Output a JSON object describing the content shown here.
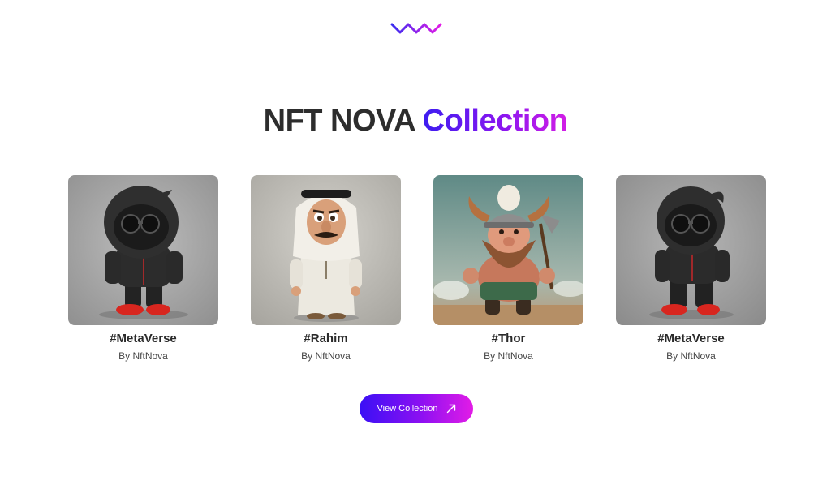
{
  "header": {
    "logo_icon": "zigzag-wave-logo-icon"
  },
  "heading": {
    "plain": "NFT NOVA",
    "accent": "Collection"
  },
  "colors": {
    "gradient_start": "#3a10f5",
    "gradient_end": "#e21ce6",
    "text": "#2d2d2d"
  },
  "cards": [
    {
      "title": "#MetaVerse",
      "author": "By NftNova",
      "image": "hooded-character-with-goggles"
    },
    {
      "title": "#Rahim",
      "author": "By NftNova",
      "image": "character-in-keffiyeh-and-thobe"
    },
    {
      "title": "#Thor",
      "author": "By NftNova",
      "image": "viking-character-with-axe"
    },
    {
      "title": "#MetaVerse",
      "author": "By NftNova",
      "image": "hooded-character-with-goggles"
    }
  ],
  "cta": {
    "label": "View Collection",
    "icon": "arrow-up-right-icon"
  }
}
